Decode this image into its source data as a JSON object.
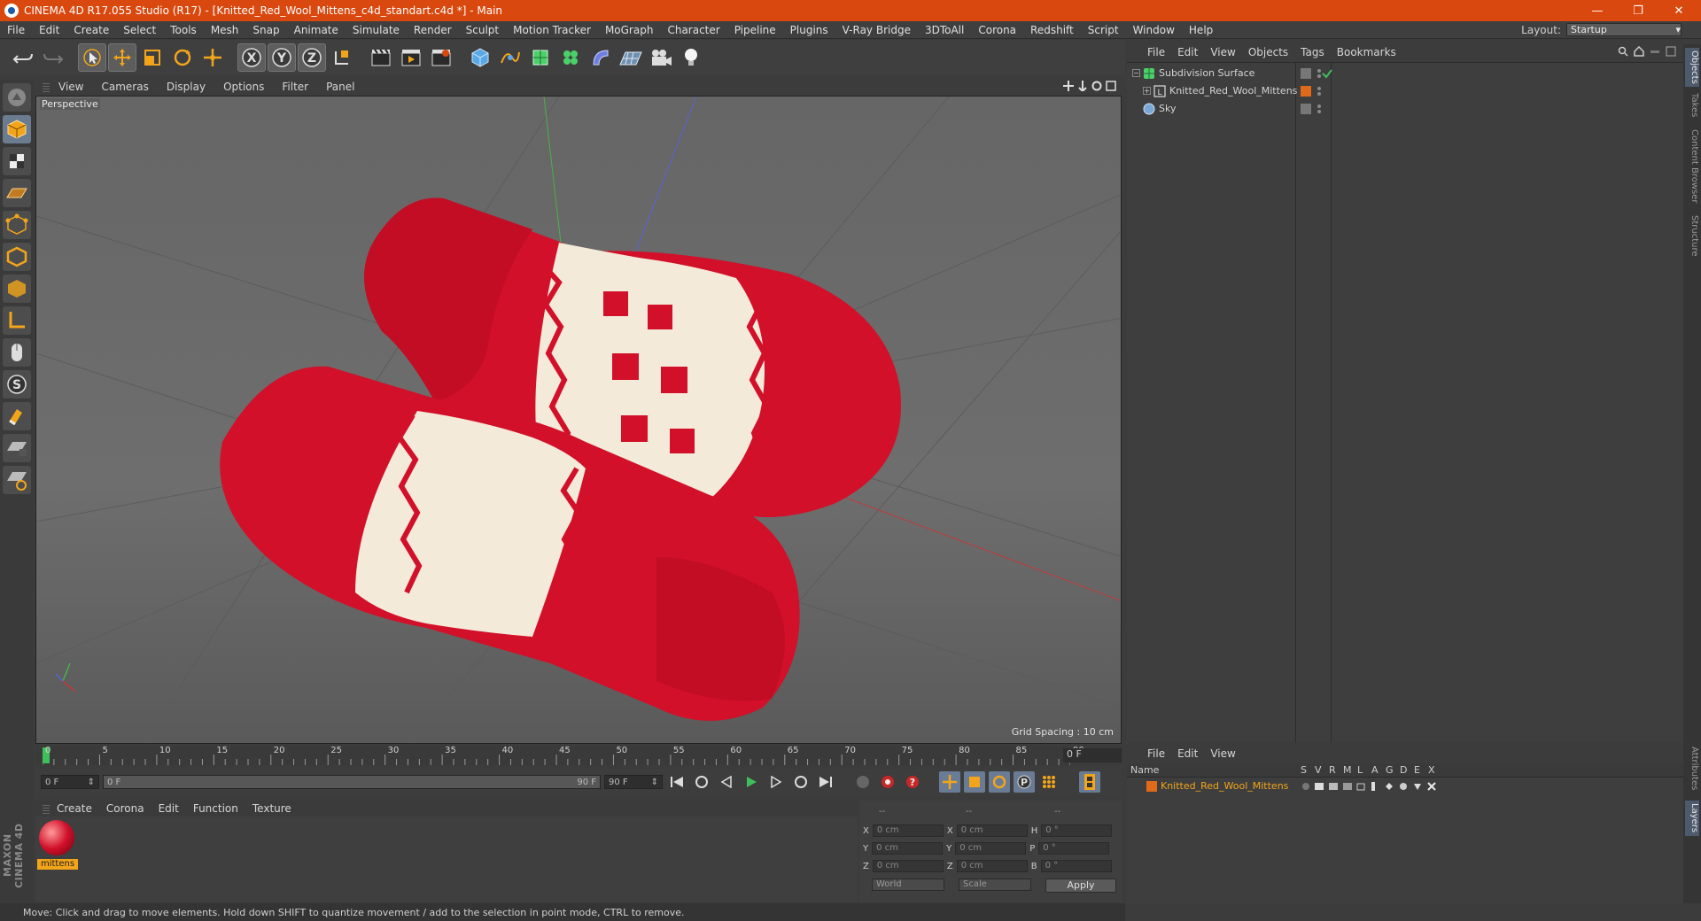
{
  "title_bar": {
    "text": "CINEMA 4D R17.055 Studio (R17) - [Knitted_Red_Wool_Mittens_c4d_standart.c4d *] - Main",
    "minimize": "—",
    "restore": "❐",
    "close": "✕"
  },
  "menu": [
    "File",
    "Edit",
    "Create",
    "Select",
    "Tools",
    "Mesh",
    "Snap",
    "Animate",
    "Simulate",
    "Render",
    "Sculpt",
    "Motion Tracker",
    "MoGraph",
    "Character",
    "Pipeline",
    "Plugins",
    "V-Ray Bridge",
    "3DToAll",
    "Corona",
    "Redshift",
    "Script",
    "Window",
    "Help"
  ],
  "layout": {
    "label": "Layout:",
    "value": "Startup"
  },
  "viewport": {
    "menu": [
      "View",
      "Cameras",
      "Display",
      "Options",
      "Filter",
      "Panel"
    ],
    "label": "Perspective",
    "grid_spacing": "Grid Spacing : 10 cm"
  },
  "timeline": {
    "ticks": [
      "0",
      "5",
      "10",
      "15",
      "20",
      "25",
      "30",
      "35",
      "40",
      "45",
      "50",
      "55",
      "60",
      "65",
      "70",
      "75",
      "80",
      "85",
      "90"
    ],
    "current_frame": "0 F",
    "start_field": "0 F",
    "range_start": "0 F",
    "range_end": "90 F",
    "end_field": "90 F"
  },
  "material_manager": {
    "menu": [
      "Create",
      "Corona",
      "Edit",
      "Function",
      "Texture"
    ],
    "material_name": "mittens"
  },
  "coordinates": {
    "headers": [
      "--",
      "--",
      "--"
    ],
    "rows": [
      {
        "a": "X",
        "v1": "0 cm",
        "b": "X",
        "v2": "0 cm",
        "c": "H",
        "v3": "0 °"
      },
      {
        "a": "Y",
        "v1": "0 cm",
        "b": "Y",
        "v2": "0 cm",
        "c": "P",
        "v3": "0 °"
      },
      {
        "a": "Z",
        "v1": "0 cm",
        "b": "Z",
        "v2": "0 cm",
        "c": "B",
        "v3": "0 °"
      }
    ],
    "mode1": "World",
    "mode2": "Scale",
    "apply": "Apply"
  },
  "object_manager": {
    "menu": [
      "File",
      "Edit",
      "View",
      "Objects",
      "Tags",
      "Bookmarks"
    ],
    "objects": [
      {
        "name": "Subdivision Surface"
      },
      {
        "name": "Knitted_Red_Wool_Mittens"
      },
      {
        "name": "Sky"
      }
    ]
  },
  "layer_manager": {
    "menu": [
      "File",
      "Edit",
      "View"
    ],
    "columns": [
      "Name",
      "S",
      "V",
      "R",
      "M",
      "L",
      "A",
      "G",
      "D",
      "E",
      "X"
    ],
    "layers": [
      {
        "name": "Knitted_Red_Wool_Mittens"
      }
    ]
  },
  "right_tabs": [
    "Objects",
    "Takes",
    "Content Browser",
    "Structure",
    "Attributes",
    "Layers"
  ],
  "status": "Move: Click and drag to move elements. Hold down SHIFT to quantize movement / add to the selection in point mode, CTRL to remove.",
  "maxon": "MAXON CINEMA 4D",
  "colors": {
    "accent": "#d9480f",
    "layer_orange": "#f2a51a",
    "mitten_red": "#d2102a",
    "wool_cream": "#f3ead9"
  }
}
